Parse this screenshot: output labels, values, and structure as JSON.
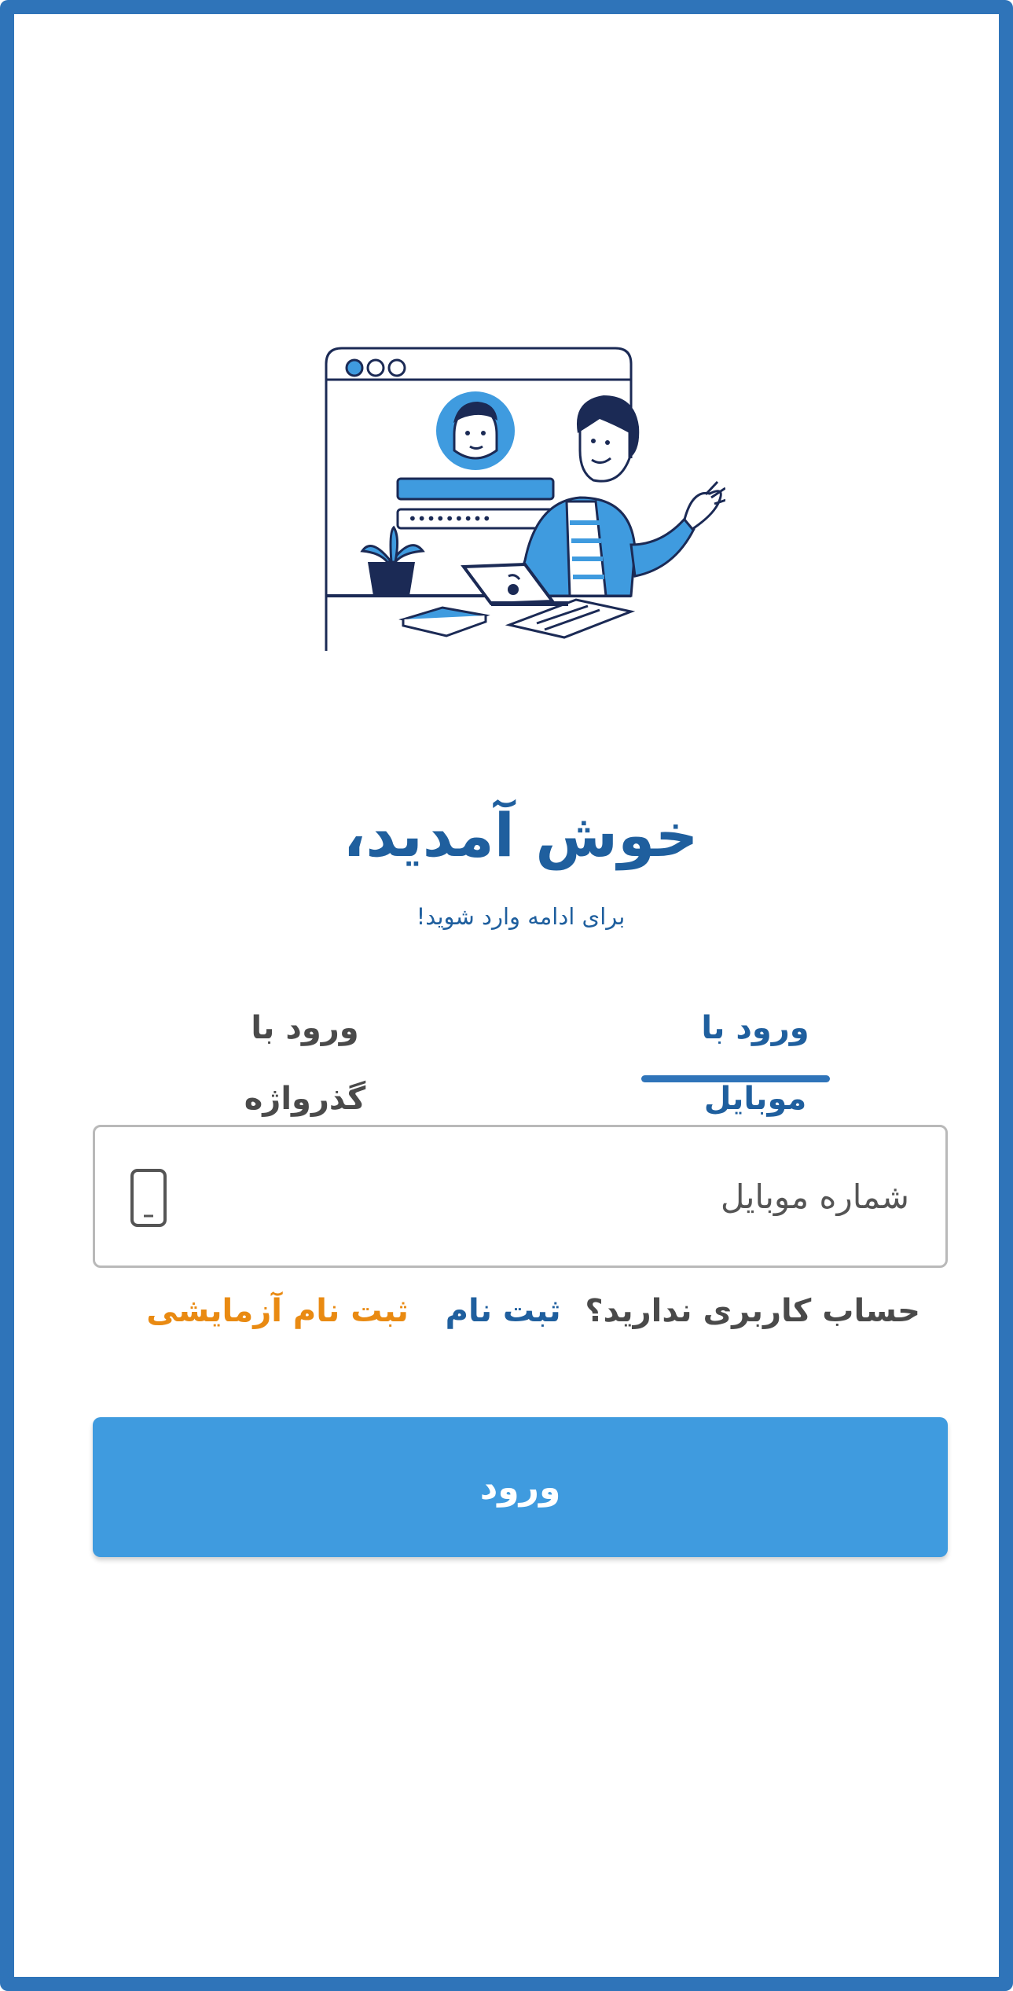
{
  "header": {
    "title": "خوش آمدید،",
    "subtitle": "برای ادامه وارد شوید!"
  },
  "tabs": [
    {
      "label": "ورود با موبایل",
      "active": true
    },
    {
      "label": "ورود با گذرواژه",
      "active": false
    }
  ],
  "phone_field": {
    "placeholder": "شماره موبایل",
    "value": "",
    "icon": "mobile-phone-icon"
  },
  "signup": {
    "question": "حساب کاربری ندارید؟",
    "signup_link": "ثبت نام",
    "trial_link": "ثبت نام آزمایشی"
  },
  "login_button": {
    "label": "ورود"
  },
  "illustration": {
    "icon": "login-illustration",
    "dots": "•••••••••"
  },
  "colors": {
    "primary": "#1f5f9e",
    "frame": "#2f74b9",
    "button": "#3f9bdf",
    "accent_orange": "#e98a12",
    "text_gray": "#4a4a4a"
  }
}
